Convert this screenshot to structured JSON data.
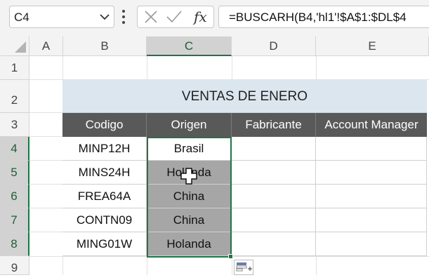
{
  "formula_bar": {
    "name_box": "C4",
    "formula": "=BUSCARH(B4,'hl1'!$A$1:$DL$4"
  },
  "columns": [
    "A",
    "B",
    "C",
    "D",
    "E"
  ],
  "rows": [
    "1",
    "2",
    "3",
    "4",
    "5",
    "6",
    "7",
    "8",
    "9"
  ],
  "sheet": {
    "title": "VENTAS DE ENERO",
    "headers": [
      "Codigo",
      "Origen",
      "Fabricante",
      "Account Manager"
    ],
    "data": [
      [
        "MINP12H",
        "Brasil",
        "",
        ""
      ],
      [
        "MINS24H",
        "Holanda",
        "",
        ""
      ],
      [
        "FREA64A",
        "China",
        "",
        ""
      ],
      [
        "CONTN09",
        "China",
        "",
        ""
      ],
      [
        "MING01W",
        "Holanda",
        "",
        ""
      ]
    ]
  },
  "colors": {
    "accent": "#217346",
    "title_fill": "#dce6ef",
    "header_fill": "#595959",
    "highlight_fill": "#a6a6a6"
  },
  "icons": [
    "chevron-down-icon",
    "more-icon",
    "cancel-icon",
    "enter-icon",
    "insert-function-icon",
    "plus-cursor-icon",
    "quick-analysis-icon"
  ]
}
